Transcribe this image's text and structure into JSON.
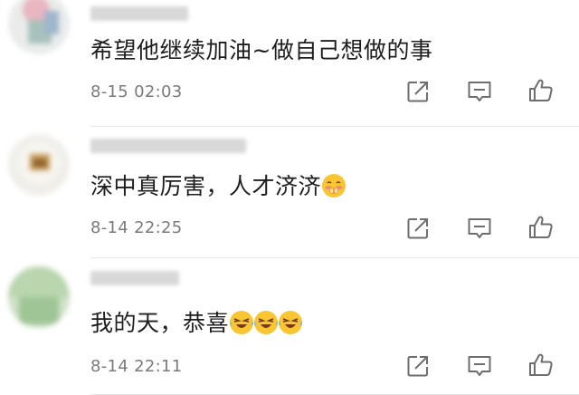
{
  "comments": [
    {
      "text": "希望他继续加油~做自己想做的事",
      "time": "8-15 02:03",
      "emojis": []
    },
    {
      "text": "深中真厉害，人才济济",
      "time": "8-14 22:25",
      "emojis": [
        "embarrassed-emoji"
      ]
    },
    {
      "text": "我的天，恭喜",
      "time": "8-14 22:11",
      "emojis": [
        "laugh-cry-emoji",
        "laugh-cry-emoji",
        "laugh-cry-emoji"
      ]
    }
  ],
  "colors": {
    "time_text": "#7a7a7a",
    "icon_stroke": "#6e6e6e",
    "divider": "#e6e6e6",
    "emoji_yellow": "#f9c531"
  },
  "icons": {
    "share": "share-icon",
    "comment": "comment-icon",
    "like": "thumbs-up-icon"
  }
}
